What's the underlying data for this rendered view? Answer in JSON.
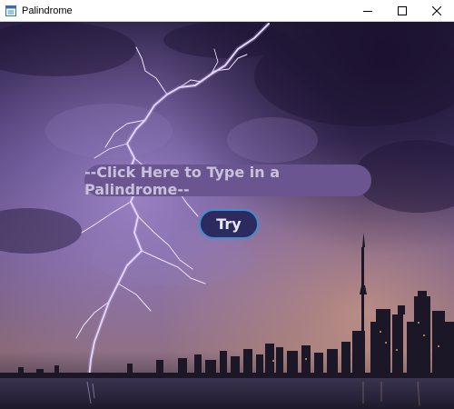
{
  "window": {
    "title": "Palindrome",
    "icon": "app-window-icon",
    "controls": [
      "minimize-icon",
      "maximize-icon",
      "close-icon"
    ]
  },
  "main": {
    "input_prompt": "--Click Here to Type in a Palindrome--",
    "try_label": "Try",
    "background": "lightning storm over city skyline at night"
  },
  "colors": {
    "input_fill": "#6a5590",
    "input_text": "#c9c1da",
    "button_fill": "#2c2a5e",
    "button_border": "#3f8fd0"
  }
}
